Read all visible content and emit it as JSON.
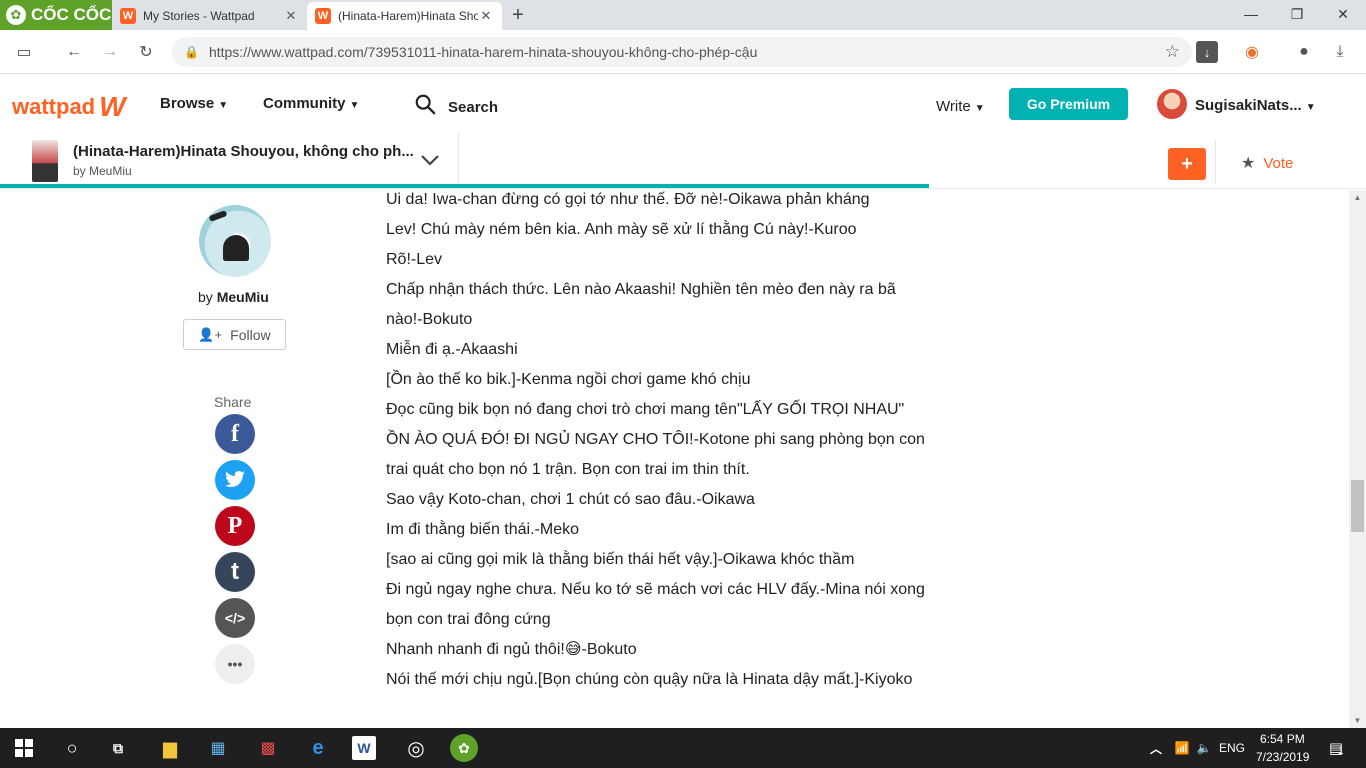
{
  "browser": {
    "brand": "CỐC CỐC",
    "tabs": [
      {
        "title": "My Stories - Wattpad"
      },
      {
        "title": "(Hinata-Harem)Hinata Sho"
      }
    ],
    "url": "https://www.wattpad.com/739531011-hinata-harem-hinata-shouyou-không-cho-phép-cậu"
  },
  "header": {
    "logo": "wattpad",
    "browse": "Browse",
    "community": "Community",
    "search": "Search",
    "write": "Write",
    "premium": "Go Premium",
    "username": "SugisakiNats..."
  },
  "story": {
    "title": "(Hinata-Harem)Hinata Shouyou, không cho ph...",
    "author_line": "by MeuMiu",
    "add": "+",
    "vote": "Vote"
  },
  "sidebar": {
    "by": "by",
    "author": "MeuMiu",
    "follow": "Follow",
    "share": "Share",
    "share_buttons": [
      {
        "label": "f",
        "color": "#3b5998"
      },
      {
        "label": "t",
        "color": "#1da1f2"
      },
      {
        "label": "P",
        "color": "#bd081c"
      },
      {
        "label": "t",
        "color": "#35465c"
      },
      {
        "label": "</>",
        "color": "#555555"
      },
      {
        "label": "•••",
        "color": "#eeeeee"
      }
    ]
  },
  "content": {
    "lines": [
      "Ui da! Iwa-chan đừng có gọi tớ như thế. Đỡ nè!-Oikawa phản kháng",
      "Lev! Chú mày ném bên kia. Anh mày sẽ xử lí thằng Cú này!-Kuroo",
      "Rõ!-Lev",
      "Chấp nhận thách thức. Lên nào Akaashi! Nghiền tên mèo đen này ra bã nào!-Bokuto",
      "Miễn đi ạ.-Akaashi",
      "[Ồn ào thế ko bik.]-Kenma ngồi chơi game khó chịu",
      "Đọc cũng bik bọn nó đang chơi trò chơi mang tên\"LẤY GỐI TRỌI NHAU\"",
      "  ỒN ÀO QUÁ ĐÓ! ĐI NGỦ NGAY CHO TÔI!-Kotone phi sang phòng bọn con trai quát cho bọn nó 1 trận. Bọn con trai im thin thít.",
      "Sao vậy Koto-chan, chơi 1 chút có sao đâu.-Oikawa",
      "Im đi thằng biến thái.-Meko",
      "[sao ai cũng gọi mik là thằng biến thái hết vậy.]-Oikawa khóc thầm",
      "Đi ngủ ngay nghe chưa. Nếu ko tớ sẽ mách vơi các HLV đấy.-Mina nói xong bọn con trai đông cứng",
      "Nhanh nhanh đi ngủ thôi!😅-Bokuto",
      "Nói thế mới chịu ngủ.[Bọn chúng còn quậy nữa là Hinata dậy mất.]-Kiyoko"
    ]
  },
  "taskbar": {
    "lang": "ENG",
    "time": "6:54 PM",
    "date": "7/23/2019",
    "notifications": "1"
  }
}
